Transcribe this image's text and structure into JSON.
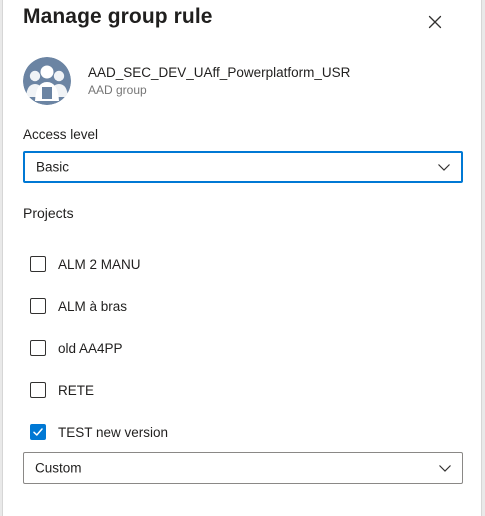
{
  "panel": {
    "title": "Manage group rule",
    "close_icon": "close-icon"
  },
  "group": {
    "avatar_icon": "group-avatar-icon",
    "name": "AAD_SEC_DEV_UAff_Powerplatform_USR",
    "type": "AAD group"
  },
  "access": {
    "label": "Access level",
    "selected": "Basic"
  },
  "projects": {
    "label": "Projects",
    "items": [
      {
        "label": "ALM 2 MANU",
        "checked": false
      },
      {
        "label": "ALM à bras",
        "checked": false
      },
      {
        "label": "old AA4PP",
        "checked": false
      },
      {
        "label": "RETE",
        "checked": false
      },
      {
        "label": "TEST new version",
        "checked": true
      }
    ],
    "role_selected": "Custom"
  },
  "colors": {
    "accent": "#0078d4",
    "avatar_bg": "#6b84a3"
  }
}
